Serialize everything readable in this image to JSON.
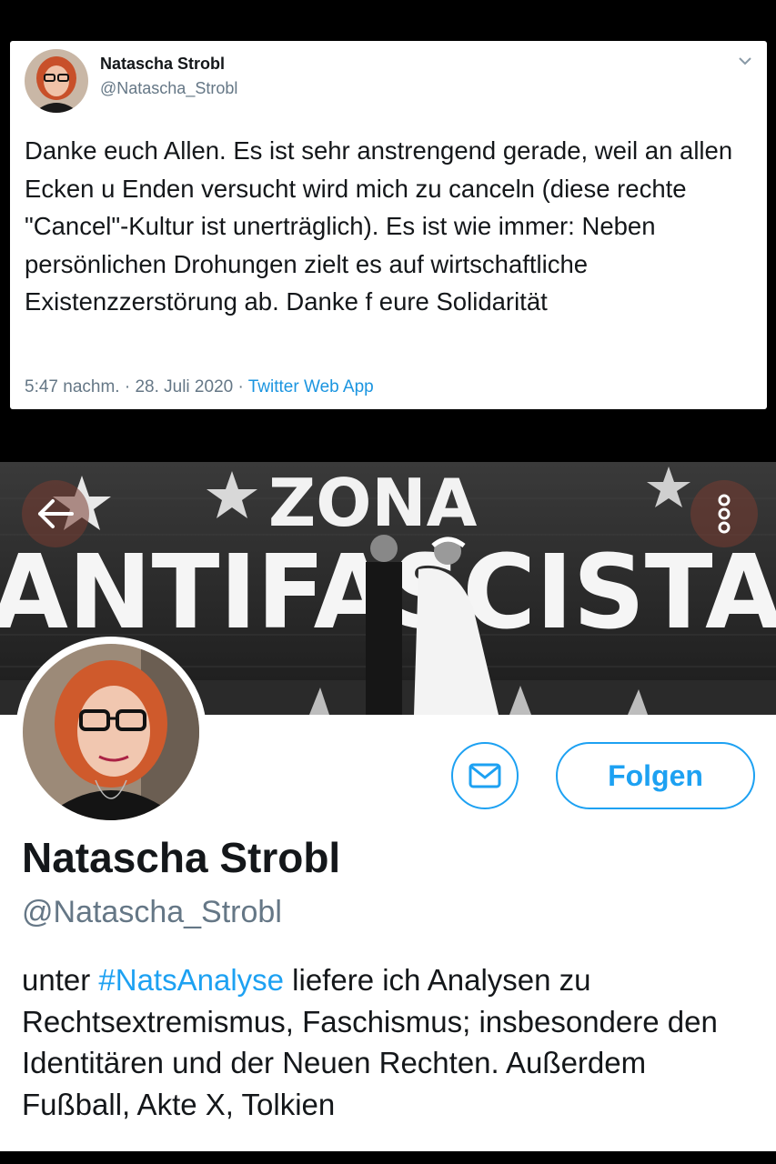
{
  "tweet": {
    "author_name": "Natascha Strobl",
    "author_handle": "@Natascha_Strobl",
    "text": "Danke euch Allen. Es ist sehr anstrengend gerade, weil an allen Ecken u Enden versucht wird mich zu canceln (diese rechte \"Cancel\"-Kultur ist unerträglich). Es ist wie immer: Neben persönlichen Drohungen zielt es auf wirtschaftliche Existenzzerstörung ab. Danke f eure Solidarität",
    "timestamp": "5:47 nachm. · 28. Juli 2020 · ",
    "source": "Twitter Web App",
    "menu_icon": "chevron-down-icon"
  },
  "profile": {
    "banner_text_line1": "ZONA",
    "banner_text_line2": "ANTIFASCISTA",
    "name": "Natascha Strobl",
    "handle": "@Natascha_Strobl",
    "follow_label": "Folgen",
    "message_icon": "mail-icon",
    "back_icon": "arrow-left-icon",
    "more_icon": "more-vertical-icon",
    "bio_prefix": "unter ",
    "bio_hashtag": "#NatsAnalyse",
    "bio_rest": " liefere ich Analysen zu Rechtsextremismus, Faschismus; insbesondere den Identitären und der Neuen Rechten. Außerdem Fußball, Akte X, Tolkien"
  },
  "colors": {
    "accent": "#1da1f2",
    "link": "#1b95e0",
    "secondary_text": "#657786",
    "primary_text": "#14171a"
  }
}
